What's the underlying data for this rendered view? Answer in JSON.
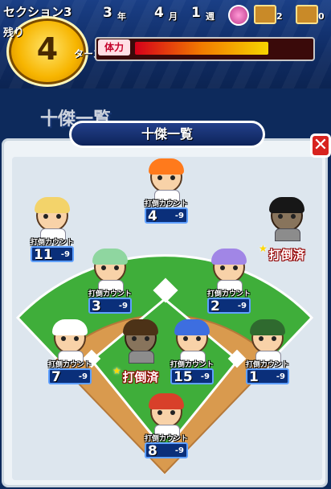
{
  "hud": {
    "section_label": "セクション3",
    "remaining_label": "残り",
    "turns_left": "4",
    "turn_label": "ターン",
    "year": "3",
    "year_unit": "年",
    "month": "4",
    "month_unit": "月",
    "week": "1",
    "week_unit": "週",
    "chest1_count": "2",
    "chest2_count": "0",
    "stamina_label": "体力",
    "stamina_level": 0.72
  },
  "background_title": "十傑一覧",
  "dialog": {
    "title": "十傑一覧",
    "close_symbol": "✕"
  },
  "count_label": "打倒カウント",
  "defeated_label": "打倒済",
  "players": [
    {
      "id": "p1",
      "count": "4",
      "max": "-9",
      "defeated": false,
      "hair": "#ff7a1c"
    },
    {
      "id": "p2",
      "count": "11",
      "max": "-9",
      "defeated": false,
      "hair": "#f3d36a"
    },
    {
      "id": "p3",
      "count": "",
      "max": "",
      "defeated": true,
      "hair": "#2a2a2a"
    },
    {
      "id": "p4",
      "count": "3",
      "max": "-9",
      "defeated": false,
      "hair": "#8fd6a0"
    },
    {
      "id": "p5",
      "count": "2",
      "max": "-9",
      "defeated": false,
      "hair": "#a186e6"
    },
    {
      "id": "p6",
      "count": "7",
      "max": "-9",
      "defeated": false,
      "hair": "#ffffff"
    },
    {
      "id": "p7",
      "count": "",
      "max": "",
      "defeated": true,
      "hair": "#8a5a2a"
    },
    {
      "id": "p8",
      "count": "15",
      "max": "-9",
      "defeated": false,
      "hair": "#3d6ee0"
    },
    {
      "id": "p9",
      "count": "1",
      "max": "-9",
      "defeated": false,
      "hair": "#2f6a2f"
    },
    {
      "id": "p10",
      "count": "8",
      "max": "-9",
      "defeated": false,
      "hair": "#d8402a"
    }
  ],
  "colors": {
    "grass": "#3fae3a",
    "dirt": "#d99a4e",
    "panel": "#eef3f7",
    "count_box": "#0a2f7a",
    "defeated": "#c00000"
  }
}
